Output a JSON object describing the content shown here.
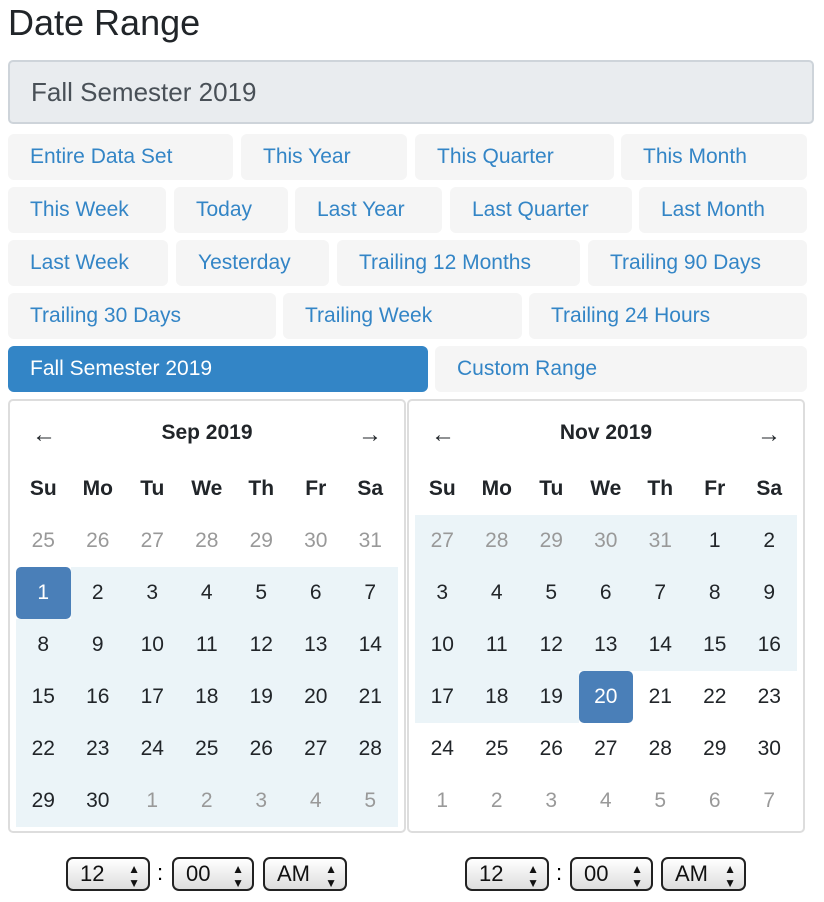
{
  "title": "Date Range",
  "display_value": "Fall Semester 2019",
  "ranges": [
    [
      "Entire Data Set",
      "This Year",
      "This Quarter",
      "This Month"
    ],
    [
      "This Week",
      "Today",
      "Last Year",
      "Last Quarter",
      "Last Month"
    ],
    [
      "Last Week",
      "Yesterday",
      "Trailing 12 Months",
      "Trailing 90 Days"
    ],
    [
      "Trailing 30 Days",
      "Trailing Week",
      "Trailing 24 Hours"
    ],
    [
      "Fall Semester 2019",
      "Custom Range"
    ]
  ],
  "active_range": "Fall Semester 2019",
  "colors": {
    "accent": "#3385c6",
    "selected_day": "#4a7fb8",
    "in_range": "#ebf4f8"
  },
  "weekdays": [
    "Su",
    "Mo",
    "Tu",
    "We",
    "Th",
    "Fr",
    "Sa"
  ],
  "calendars": [
    {
      "month": "Sep 2019",
      "prev_icon": "arrow-left",
      "next_icon": "arrow-right",
      "weeks": [
        [
          25,
          26,
          27,
          28,
          29,
          30,
          31
        ],
        [
          1,
          2,
          3,
          4,
          5,
          6,
          7
        ],
        [
          8,
          9,
          10,
          11,
          12,
          13,
          14
        ],
        [
          15,
          16,
          17,
          18,
          19,
          20,
          21
        ],
        [
          22,
          23,
          24,
          25,
          26,
          27,
          28
        ],
        [
          29,
          30,
          1,
          2,
          3,
          4,
          5
        ]
      ],
      "off": [
        [
          0,
          0
        ],
        [
          0,
          1
        ],
        [
          0,
          2
        ],
        [
          0,
          3
        ],
        [
          0,
          4
        ],
        [
          0,
          5
        ],
        [
          0,
          6
        ],
        [
          5,
          2
        ],
        [
          5,
          3
        ],
        [
          5,
          4
        ],
        [
          5,
          5
        ],
        [
          5,
          6
        ]
      ],
      "in_range_from": [
        1,
        0
      ],
      "in_range_to": [
        5,
        6
      ],
      "selected": [
        1,
        0
      ]
    },
    {
      "month": "Nov 2019",
      "prev_icon": "arrow-left",
      "next_icon": "arrow-right",
      "weeks": [
        [
          27,
          28,
          29,
          30,
          31,
          1,
          2
        ],
        [
          3,
          4,
          5,
          6,
          7,
          8,
          9
        ],
        [
          10,
          11,
          12,
          13,
          14,
          15,
          16
        ],
        [
          17,
          18,
          19,
          20,
          21,
          22,
          23
        ],
        [
          24,
          25,
          26,
          27,
          28,
          29,
          30
        ],
        [
          1,
          2,
          3,
          4,
          5,
          6,
          7
        ]
      ],
      "off": [
        [
          0,
          0
        ],
        [
          0,
          1
        ],
        [
          0,
          2
        ],
        [
          0,
          3
        ],
        [
          0,
          4
        ],
        [
          5,
          0
        ],
        [
          5,
          1
        ],
        [
          5,
          2
        ],
        [
          5,
          3
        ],
        [
          5,
          4
        ],
        [
          5,
          5
        ],
        [
          5,
          6
        ]
      ],
      "in_range_from": [
        0,
        0
      ],
      "in_range_to": [
        3,
        3
      ],
      "selected": [
        3,
        3
      ]
    }
  ],
  "time_start": {
    "hour": "12",
    "minute": "00",
    "ampm": "AM"
  },
  "time_end": {
    "hour": "12",
    "minute": "00",
    "ampm": "AM"
  },
  "time_separator": ":"
}
